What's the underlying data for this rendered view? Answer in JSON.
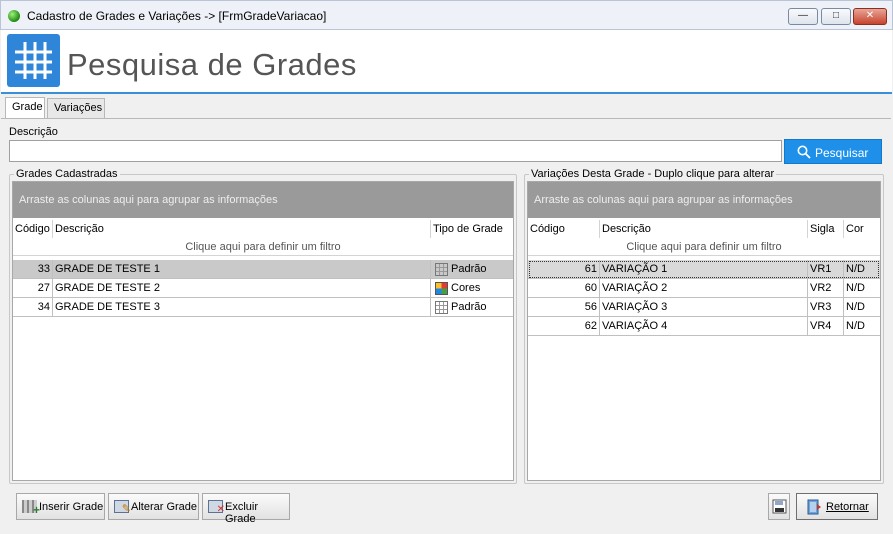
{
  "window": {
    "title": "Cadastro de Grades e Variações -> [FrmGradeVariacao]",
    "minimize_glyph": "—",
    "maximize_glyph": "□",
    "close_glyph": "✕"
  },
  "header": {
    "title": "Pesquisa de Grades"
  },
  "tabs": [
    {
      "label": "Grade"
    },
    {
      "label": "Variações"
    }
  ],
  "search": {
    "label": "Descrição",
    "value": "",
    "button_label": "Pesquisar"
  },
  "left_panel": {
    "title": "Grades Cadastradas",
    "group_hint": "Arraste as colunas aqui para agrupar as informações",
    "filter_hint": "Clique aqui para definir um filtro",
    "columns": [
      "Código",
      "Descrição",
      "Tipo de Grade"
    ],
    "rows": [
      {
        "codigo": "33",
        "descricao": "GRADE DE TESTE 1",
        "tipo": "Padrão",
        "icon": "grid-icon"
      },
      {
        "codigo": "27",
        "descricao": "GRADE DE TESTE 2",
        "tipo": "Cores",
        "icon": "color-palette-icon"
      },
      {
        "codigo": "34",
        "descricao": "GRADE DE TESTE 3",
        "tipo": "Padrão",
        "icon": "grid-icon"
      }
    ]
  },
  "right_panel": {
    "title": "Variações Desta Grade - Duplo clique para alterar",
    "group_hint": "Arraste as colunas aqui para agrupar as informações",
    "filter_hint": "Clique aqui para definir um filtro",
    "columns": [
      "Código",
      "Descrição",
      "Sigla",
      "Cor"
    ],
    "rows": [
      {
        "codigo": "61",
        "descricao": "VARIAÇÃO 1",
        "sigla": "VR1",
        "cor": "N/D"
      },
      {
        "codigo": "60",
        "descricao": "VARIAÇÃO 2",
        "sigla": "VR2",
        "cor": "N/D"
      },
      {
        "codigo": "56",
        "descricao": "VARIAÇÃO 3",
        "sigla": "VR3",
        "cor": "N/D"
      },
      {
        "codigo": "62",
        "descricao": "VARIAÇÃO 4",
        "sigla": "VR4",
        "cor": "N/D"
      }
    ]
  },
  "footer": {
    "insert_label": "Inserir Grade",
    "edit_label": "Alterar Grade",
    "delete_label": "Excluir Grade",
    "return_label": "Retornar"
  },
  "colors": {
    "accent": "#1e90ea",
    "header_line": "#3a8fd6",
    "logo": "#2f86d8"
  }
}
